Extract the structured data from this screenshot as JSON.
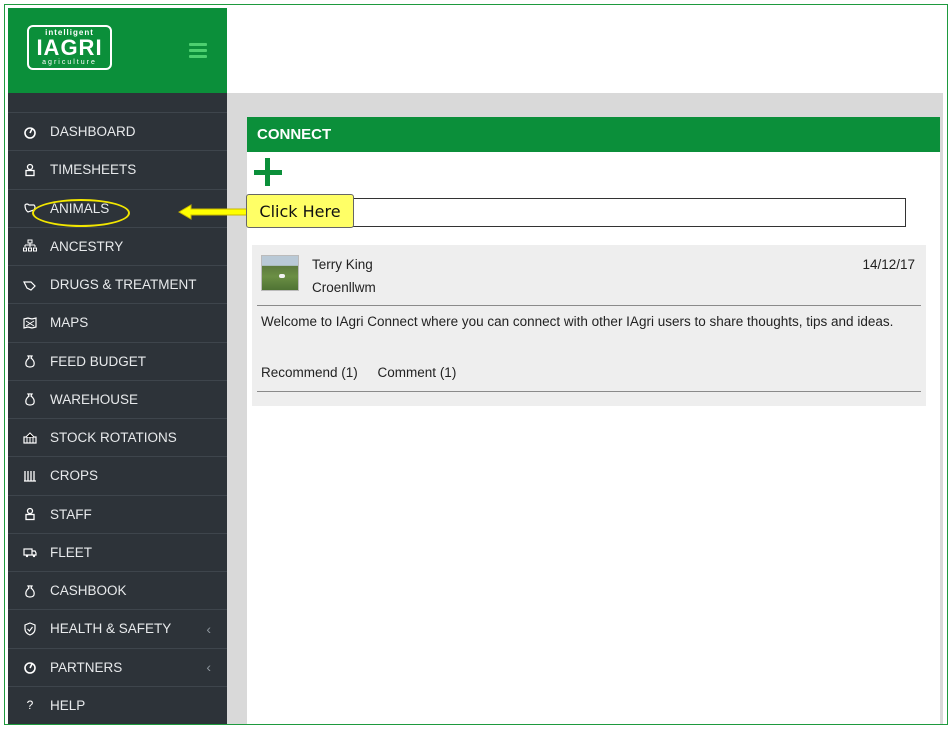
{
  "brand": {
    "logo_top": "intelligent",
    "logo_main": "IAGRI",
    "logo_bottom": "agriculture"
  },
  "menu": [
    {
      "label": "DASHBOARD",
      "icon": "dashboard-icon"
    },
    {
      "label": "TIMESHEETS",
      "icon": "person-icon"
    },
    {
      "label": "ANIMALS",
      "icon": "animal-icon"
    },
    {
      "label": "ANCESTRY",
      "icon": "sitemap-icon"
    },
    {
      "label": "DRUGS & TREATMENT",
      "icon": "treatment-icon"
    },
    {
      "label": "MAPS",
      "icon": "map-icon"
    },
    {
      "label": "FEED BUDGET",
      "icon": "money-bag-icon"
    },
    {
      "label": "WAREHOUSE",
      "icon": "money-bag-icon"
    },
    {
      "label": "STOCK ROTATIONS",
      "icon": "rotation-icon"
    },
    {
      "label": "CROPS",
      "icon": "crops-icon"
    },
    {
      "label": "STAFF",
      "icon": "person-icon"
    },
    {
      "label": "FLEET",
      "icon": "truck-icon"
    },
    {
      "label": "CASHBOOK",
      "icon": "money-bag-icon"
    },
    {
      "label": "HEALTH & SAFETY",
      "icon": "shield-icon",
      "chevron": "‹"
    },
    {
      "label": "PARTNERS",
      "icon": "dashboard-icon",
      "chevron": "‹"
    },
    {
      "label": "HELP",
      "icon": "question-icon"
    }
  ],
  "connect": {
    "title": "CONNECT",
    "input_value": "",
    "post": {
      "author": "Terry King",
      "farm": "Croenllwm",
      "date": "14/12/17",
      "text": "Welcome to IAgri Connect where you can connect with other IAgri users to share thoughts, tips and ideas.",
      "recommend": "Recommend (1)",
      "comment": "Comment (1)"
    }
  },
  "annotation": {
    "callout": "Click Here"
  },
  "colors": {
    "brand_green": "#0b8f3a",
    "sidebar": "#2d3339",
    "highlight": "#ffff66"
  }
}
